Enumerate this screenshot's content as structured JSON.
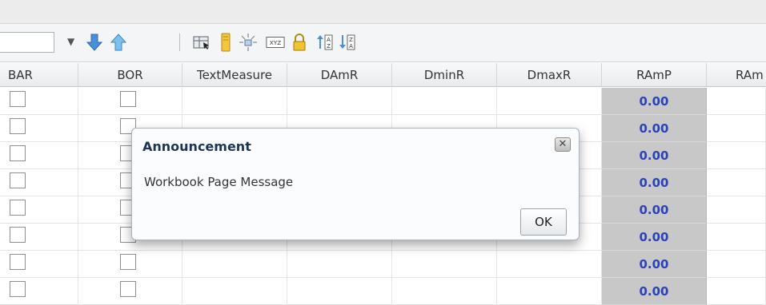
{
  "toolbar": {
    "input_value": "",
    "icons": [
      "caret-down-icon",
      "move-down-icon",
      "move-up-icon",
      "select-columns-icon",
      "highlight-icon",
      "explode-icon",
      "xyz-icon",
      "lock-icon",
      "sort-ascending-icon",
      "sort-descending-icon"
    ]
  },
  "grid": {
    "columns": [
      "BAR",
      "BOR",
      "TextMeasure",
      "DAmR",
      "DminR",
      "DmaxR",
      "RAmP",
      "RAm"
    ],
    "ramp_values": [
      "0.00",
      "0.00",
      "0.00",
      "0.00",
      "0.00",
      "0.00",
      "0.00",
      "0.00"
    ]
  },
  "dialog": {
    "title": "Announcement",
    "message": "Workbook Page Message",
    "ok_label": "OK",
    "close_glyph": "✕"
  },
  "colors": {
    "ramp_bg": "#c8c8c8",
    "ramp_text": "#2a43b8",
    "dialog_title": "#1d3557"
  }
}
